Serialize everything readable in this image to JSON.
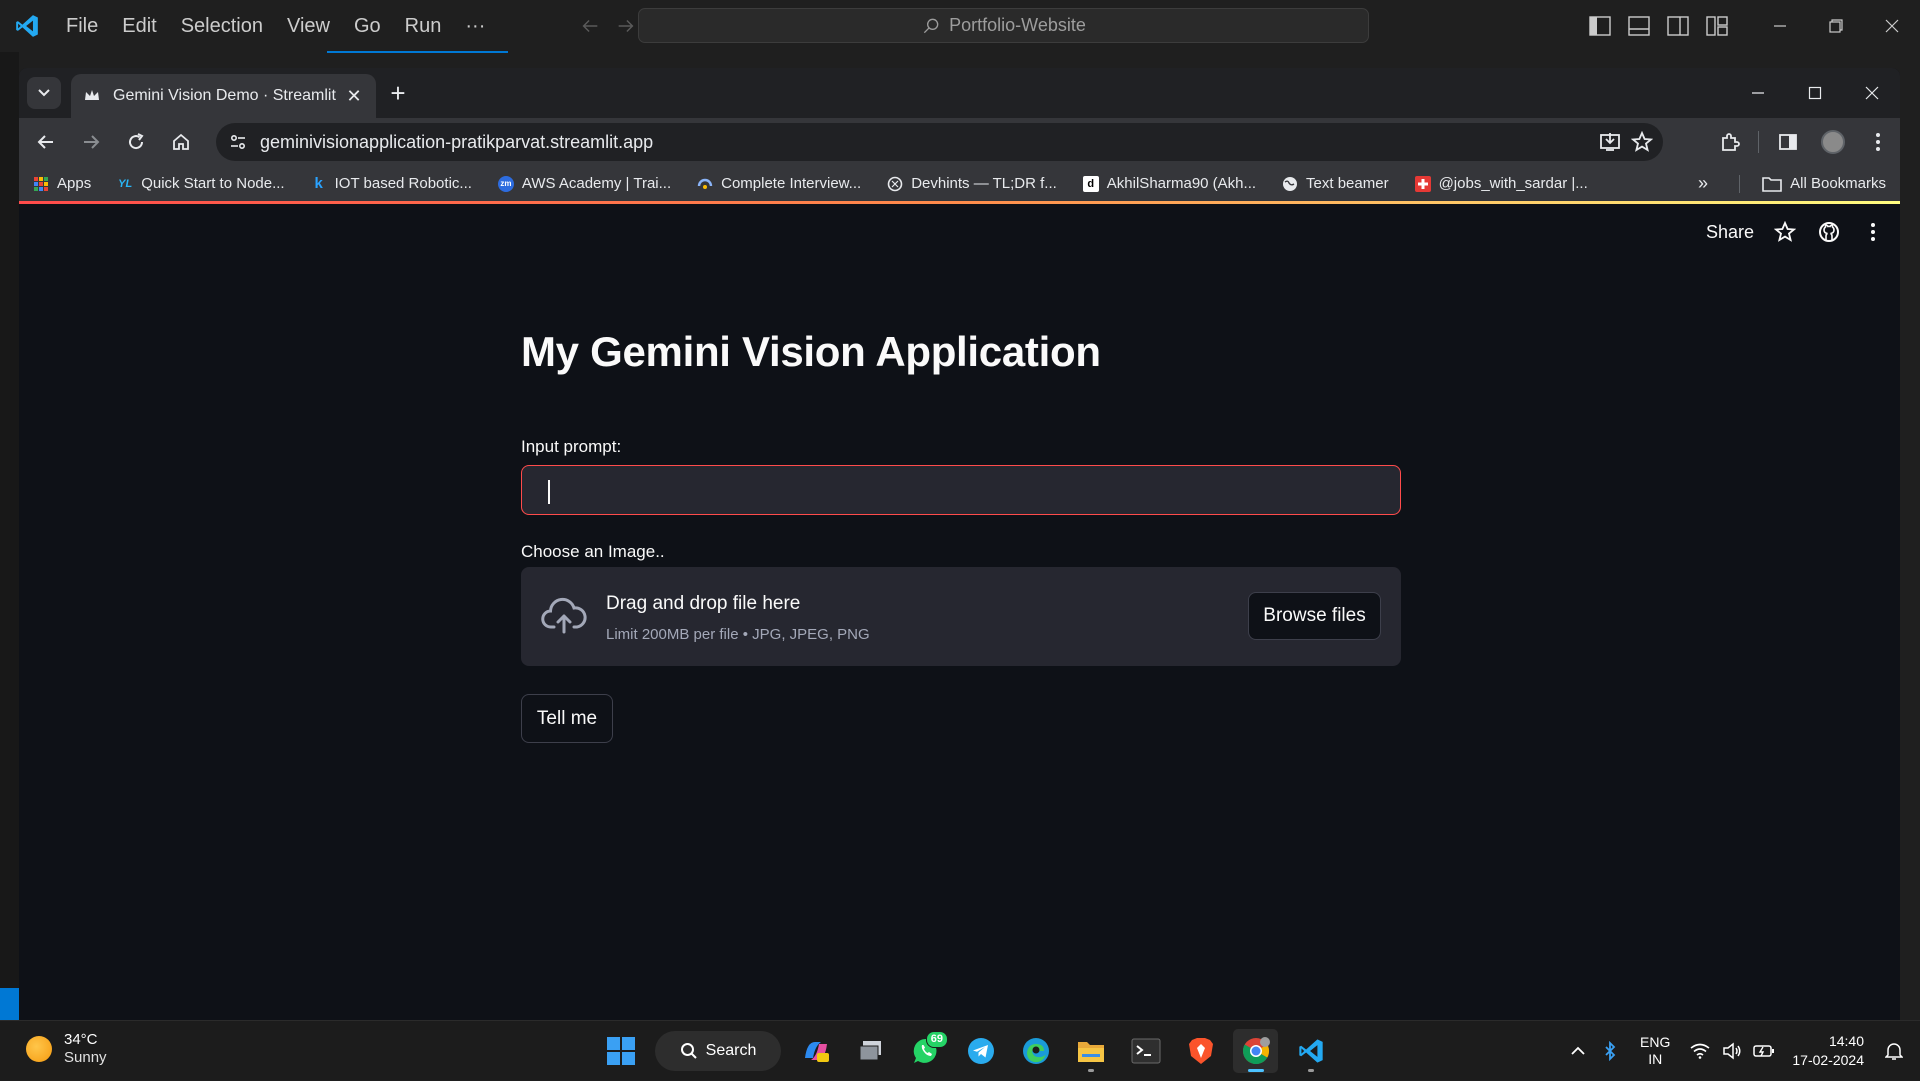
{
  "vscode": {
    "menu": [
      "File",
      "Edit",
      "Selection",
      "View",
      "Go",
      "Run",
      "···"
    ],
    "search_text": "Portfolio-Website"
  },
  "chrome": {
    "tab_title": "Gemini Vision Demo · Streamlit",
    "tab_close": "✕",
    "new_tab": "+",
    "url": "geminivisionapplication-pratikparvat.streamlit.app",
    "bookmarks": [
      {
        "label": "Apps",
        "icon": "apps-grid-icon"
      },
      {
        "label": "Quick Start to Node...",
        "icon": "yl-icon"
      },
      {
        "label": "IOT based Robotic...",
        "icon": "k-icon"
      },
      {
        "label": "AWS Academy | Trai...",
        "icon": "zm-icon"
      },
      {
        "label": "Complete Interview...",
        "icon": "gfg-icon"
      },
      {
        "label": "Devhints — TL;DR f...",
        "icon": "devhints-icon"
      },
      {
        "label": "AkhilSharma90 (Akh...",
        "icon": "d-icon"
      },
      {
        "label": "Text beamer",
        "icon": "globe-icon"
      },
      {
        "label": "@jobs_with_sardar |...",
        "icon": "red-square-icon"
      }
    ],
    "bookmarks_more": "»",
    "all_bookmarks": "All Bookmarks"
  },
  "app": {
    "share_label": "Share",
    "title": "My Gemini Vision Application",
    "prompt_label": "Input prompt:",
    "prompt_value": "",
    "image_label": "Choose an Image..",
    "drop_title": "Drag and drop file here",
    "drop_subtitle": "Limit 200MB per file • JPG, JPEG, PNG",
    "browse_label": "Browse files",
    "submit_label": "Tell me"
  },
  "taskbar": {
    "temperature": "34°C",
    "condition": "Sunny",
    "search_label": "Search",
    "whatsapp_badge": "69",
    "lang_line1": "ENG",
    "lang_line2": "IN",
    "time": "14:40",
    "date": "17-02-2024"
  },
  "colors": {
    "accent_red": "#ff4b4b",
    "vscode_blue": "#0078d4",
    "app_bg": "#0e1117",
    "widget_bg": "#262730"
  }
}
